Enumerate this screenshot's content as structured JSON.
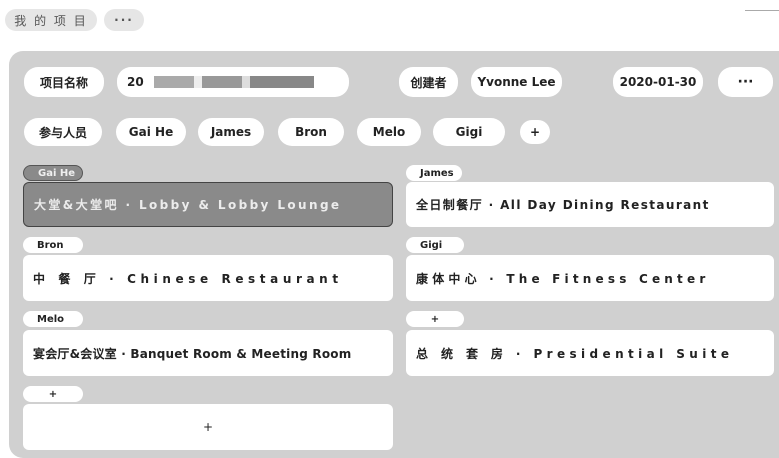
{
  "top": {
    "title": "我 的 项 目",
    "more": "···"
  },
  "header": {
    "project_name_label": "项目名称",
    "project_name_value": "20",
    "creator_label": "创建者",
    "creator_value": "Yvonne Lee",
    "date": "2020-01-30",
    "more": "···"
  },
  "members": {
    "label": "参与人员",
    "items": [
      "Gai He",
      "James",
      "Bron",
      "Melo",
      "Gigi"
    ],
    "add": "+"
  },
  "areas": [
    {
      "owner": "Gai He",
      "name": "大堂&大堂吧 · Lobby & Lobby Lounge"
    },
    {
      "owner": "James",
      "name": "全日制餐厅 · All Day Dining Restaurant"
    },
    {
      "owner": "Bron",
      "name": "中 餐 厅 · Chinese Restaurant"
    },
    {
      "owner": "Gigi",
      "name": "康体中心 · The Fitness Center"
    },
    {
      "owner": "Melo",
      "name": "宴会厅&会议室 · Banquet Room & Meeting Room"
    },
    {
      "owner": "+",
      "name": "总 统 套 房 · Presidential Suite"
    },
    {
      "owner": "+",
      "name": "+"
    }
  ],
  "colors": {
    "panel": "#d0d0d0",
    "selected": "#8a8a8a"
  }
}
